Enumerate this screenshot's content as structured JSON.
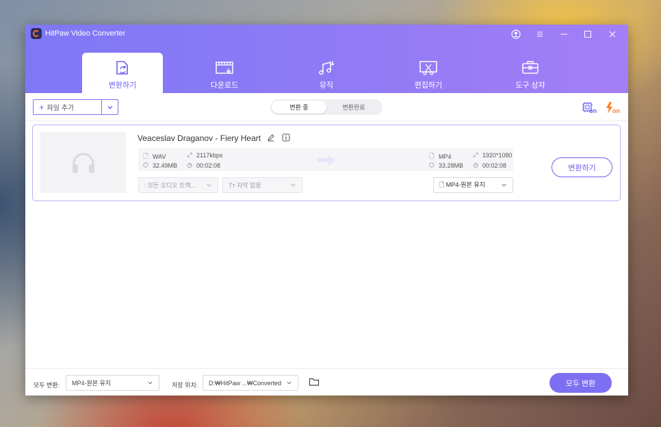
{
  "window": {
    "title": "HitPaw Video Converter"
  },
  "tabs": [
    {
      "label": "변환하기",
      "icon": "convert-file-icon",
      "active": true
    },
    {
      "label": "다운로드",
      "icon": "download-film-icon",
      "active": false
    },
    {
      "label": "뮤직",
      "icon": "music-note-icon",
      "active": false
    },
    {
      "label": "편집하기",
      "icon": "edit-cut-icon",
      "active": false
    },
    {
      "label": "도구 상자",
      "icon": "toolbox-icon",
      "active": false
    }
  ],
  "toolbar": {
    "add_file_label": "파일 추가",
    "segment": {
      "converting": "변환 중",
      "converted": "변환완료"
    },
    "hw_accel_label": "on",
    "speed_label": "on"
  },
  "file": {
    "name": "Veaceslav Draganov - Fiery Heart",
    "source": {
      "format": "WAV",
      "bitrate": "2117kbps",
      "size": "32.49MB",
      "duration": "00:02:08"
    },
    "target": {
      "format": "MP4",
      "resolution": "1920*1080",
      "size": "33.28MB",
      "duration": "00:02:08"
    },
    "audio_track_placeholder": "모든 오디오 트랙...",
    "subtitle_placeholder": "자막 없음",
    "output_format": "MP4-원본 유지",
    "convert_label": "변환하기"
  },
  "footer": {
    "convert_all_label": "모두 변환:",
    "convert_all_format": "MP4-원본 유지",
    "save_location_label": "저장 위치:",
    "save_location_value": "D:₩HitPaw ...₩Converted",
    "convert_all_button": "모두 변환"
  },
  "colors": {
    "accent": "#7e6ff2",
    "header_start": "#7f78f5",
    "header_end": "#a37ff7",
    "speed_icon": "#ff7a1a"
  }
}
